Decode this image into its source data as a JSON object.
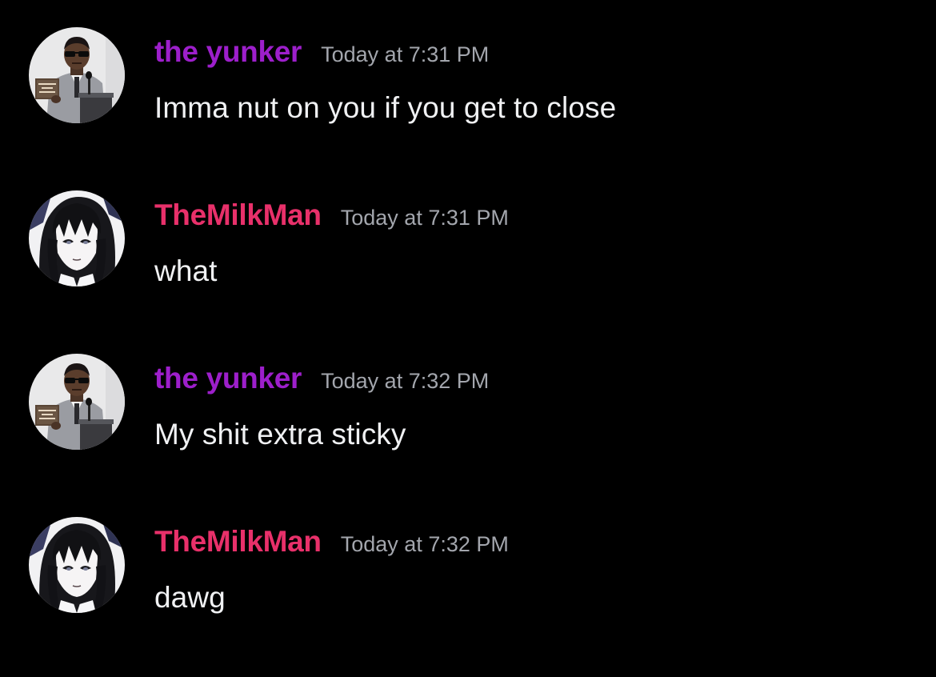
{
  "colors": {
    "background": "#000000",
    "yunker_name": "#9d1fcb",
    "milkman_name": "#e8306a",
    "timestamp": "#a3a6ad",
    "message_text": "#f0f1f3"
  },
  "messages": [
    {
      "author": "the yunker",
      "timestamp": "Today at 7:31 PM",
      "content": "Imma nut on you if you get to close",
      "avatar": "yunker-avatar"
    },
    {
      "author": "TheMilkMan",
      "timestamp": "Today at 7:31 PM",
      "content": "what",
      "avatar": "milkman-avatar"
    },
    {
      "author": "the yunker",
      "timestamp": "Today at 7:32 PM",
      "content": "My shit extra sticky",
      "avatar": "yunker-avatar"
    },
    {
      "author": "TheMilkMan",
      "timestamp": "Today at 7:32 PM",
      "content": "dawg",
      "avatar": "milkman-avatar"
    }
  ]
}
